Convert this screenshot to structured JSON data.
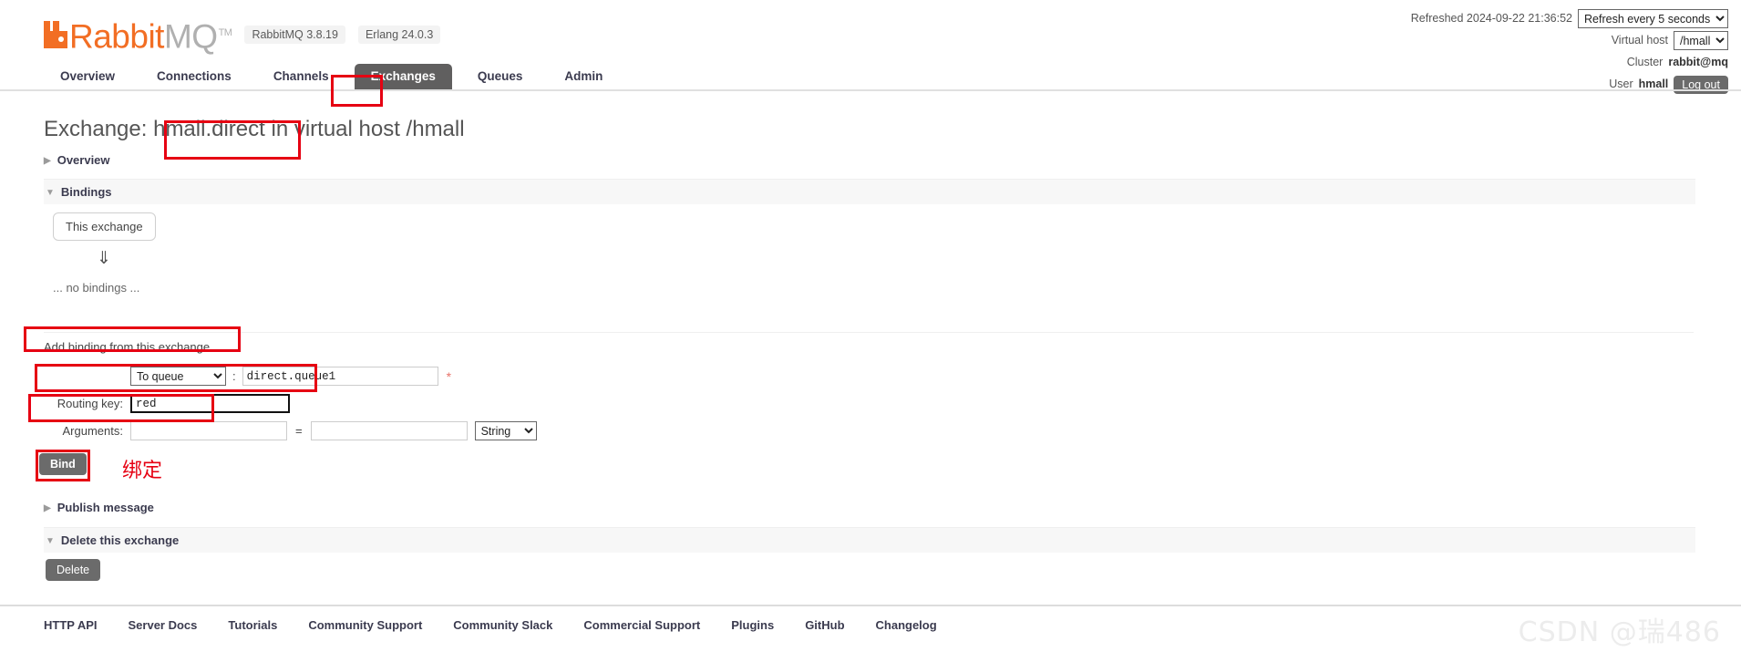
{
  "brand": {
    "name_primary": "Rabbit",
    "name_secondary": "MQ",
    "trademark": "TM",
    "version_rabbitmq": "RabbitMQ 3.8.19",
    "version_erlang": "Erlang 24.0.3"
  },
  "header_right": {
    "refreshed_label": "Refreshed 2024-09-22 21:36:52",
    "refresh_select": "Refresh every 5 seconds",
    "vhost_label": "Virtual host",
    "vhost_select": "/hmall",
    "cluster_label": "Cluster",
    "cluster_value": "rabbit@mq",
    "user_label": "User",
    "user_value": "hmall",
    "logout_label": "Log out"
  },
  "nav": {
    "items": [
      {
        "label": "Overview",
        "active": false
      },
      {
        "label": "Connections",
        "active": false
      },
      {
        "label": "Channels",
        "active": false
      },
      {
        "label": "Exchanges",
        "active": true
      },
      {
        "label": "Queues",
        "active": false
      },
      {
        "label": "Admin",
        "active": false
      }
    ]
  },
  "page": {
    "title_prefix": "Exchange:",
    "exchange_name": "hmall.direct",
    "title_suffix": "in virtual host /hmall"
  },
  "sections": {
    "overview": {
      "label": "Overview",
      "triangle": "▶",
      "expanded": false
    },
    "bindings": {
      "label": "Bindings",
      "triangle": "▼",
      "expanded": true
    },
    "publish_message": {
      "label": "Publish message",
      "triangle": "▶",
      "expanded": false
    },
    "delete_exchange": {
      "label": "Delete this exchange",
      "triangle": "▼",
      "expanded": true
    }
  },
  "bindings_diagram": {
    "source_chip": "This exchange",
    "arrow": "⇓",
    "empty_text": "... no bindings ..."
  },
  "add_binding": {
    "heading": "Add binding from this exchange",
    "destination_select": "To queue",
    "destination_separator": ":",
    "destination_value": "direct.queue1",
    "required_marker": "*",
    "routing_key_label": "Routing key:",
    "routing_key_value": "red",
    "arguments_label": "Arguments:",
    "arguments_key": "",
    "arguments_equals": "=",
    "arguments_value": "",
    "arguments_type_select": "String",
    "bind_button": "Bind"
  },
  "delete_section": {
    "delete_button": "Delete"
  },
  "annotations": {
    "bind_note_cn": "绑定",
    "color": "#e60012"
  },
  "footer": {
    "links": [
      "HTTP API",
      "Server Docs",
      "Tutorials",
      "Community Support",
      "Community Slack",
      "Commercial Support",
      "Plugins",
      "GitHub",
      "Changelog"
    ]
  },
  "watermark": {
    "text": "CSDN @瑞486"
  }
}
